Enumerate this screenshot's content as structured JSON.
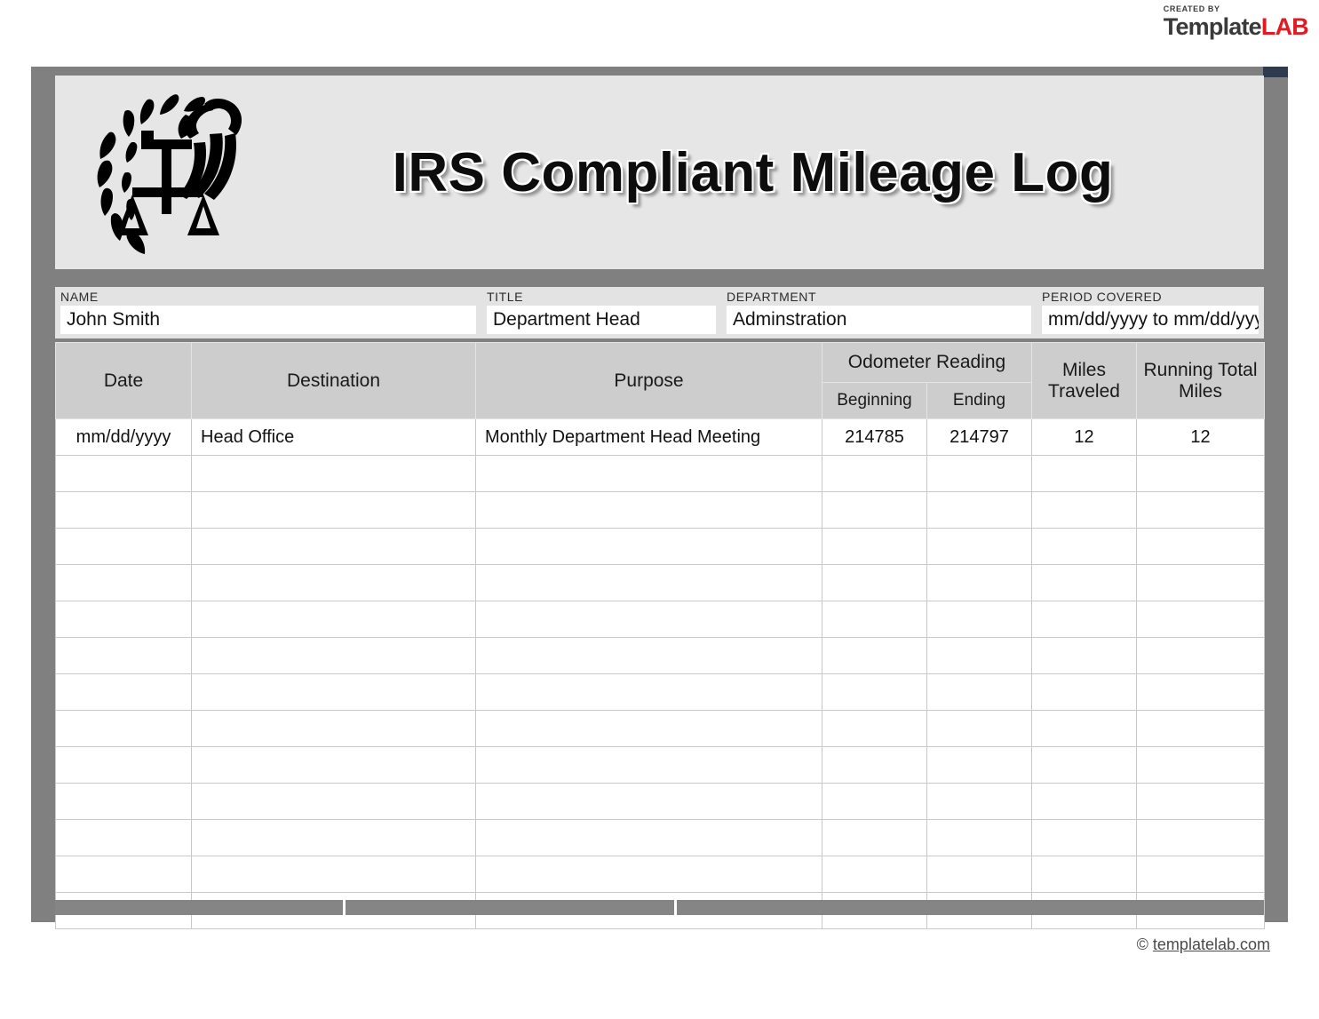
{
  "brand": {
    "created_by": "CREATED BY",
    "name_dark": "Template",
    "name_accent": "LAB",
    "accent_color": "#e01b24"
  },
  "header": {
    "title": "IRS Compliant Mileage Log",
    "logo_name": "irs-eagle-scales-logo"
  },
  "meta_fields": [
    {
      "label": "NAME",
      "value": "John Smith"
    },
    {
      "label": "TITLE",
      "value": "Department Head"
    },
    {
      "label": "DEPARTMENT",
      "value": "Adminstration"
    },
    {
      "label": "PERIOD COVERED",
      "value": "mm/dd/yyyy to mm/dd/yyyy"
    }
  ],
  "table": {
    "headers": {
      "date": "Date",
      "destination": "Destination",
      "purpose": "Purpose",
      "odometer_group": "Odometer Reading",
      "beginning": "Beginning",
      "ending": "Ending",
      "miles_traveled": "Miles Traveled",
      "running_total": "Running Total Miles"
    },
    "rows": [
      {
        "date": "mm/dd/yyyy",
        "destination": "Head Office",
        "purpose": "Monthly Department Head Meeting",
        "beginning": "214785",
        "ending": "214797",
        "miles": "12",
        "running": "12"
      },
      {
        "date": "",
        "destination": "",
        "purpose": "",
        "beginning": "",
        "ending": "",
        "miles": "",
        "running": ""
      },
      {
        "date": "",
        "destination": "",
        "purpose": "",
        "beginning": "",
        "ending": "",
        "miles": "",
        "running": ""
      },
      {
        "date": "",
        "destination": "",
        "purpose": "",
        "beginning": "",
        "ending": "",
        "miles": "",
        "running": ""
      },
      {
        "date": "",
        "destination": "",
        "purpose": "",
        "beginning": "",
        "ending": "",
        "miles": "",
        "running": ""
      },
      {
        "date": "",
        "destination": "",
        "purpose": "",
        "beginning": "",
        "ending": "",
        "miles": "",
        "running": ""
      },
      {
        "date": "",
        "destination": "",
        "purpose": "",
        "beginning": "",
        "ending": "",
        "miles": "",
        "running": ""
      },
      {
        "date": "",
        "destination": "",
        "purpose": "",
        "beginning": "",
        "ending": "",
        "miles": "",
        "running": ""
      },
      {
        "date": "",
        "destination": "",
        "purpose": "",
        "beginning": "",
        "ending": "",
        "miles": "",
        "running": ""
      },
      {
        "date": "",
        "destination": "",
        "purpose": "",
        "beginning": "",
        "ending": "",
        "miles": "",
        "running": ""
      },
      {
        "date": "",
        "destination": "",
        "purpose": "",
        "beginning": "",
        "ending": "",
        "miles": "",
        "running": ""
      },
      {
        "date": "",
        "destination": "",
        "purpose": "",
        "beginning": "",
        "ending": "",
        "miles": "",
        "running": ""
      },
      {
        "date": "",
        "destination": "",
        "purpose": "",
        "beginning": "",
        "ending": "",
        "miles": "",
        "running": ""
      },
      {
        "date": "",
        "destination": "",
        "purpose": "",
        "beginning": "",
        "ending": "",
        "miles": "",
        "running": ""
      }
    ]
  },
  "footer": {
    "copyright_symbol": "©",
    "site": "templatelab.com"
  },
  "colors": {
    "frame_gray": "#808080",
    "banner_gray": "#e6e6e6",
    "header_cell_gray": "#cdcdcd",
    "meta_band_gray": "#e3e3e3",
    "notch_navy": "#2e3a4d"
  }
}
